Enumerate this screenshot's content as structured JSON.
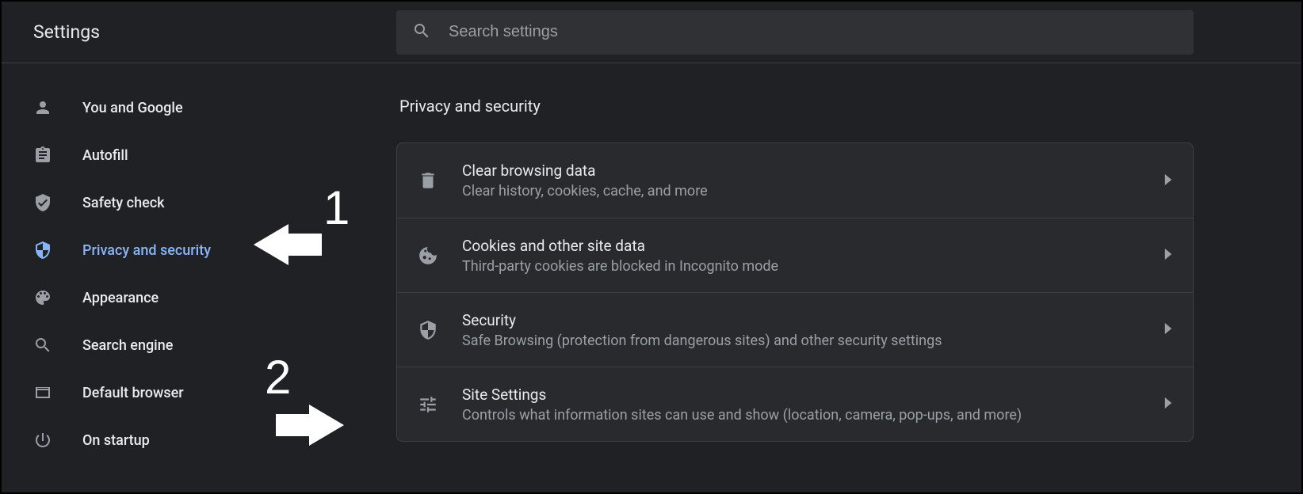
{
  "app_title": "Settings",
  "search": {
    "placeholder": "Search settings"
  },
  "sidebar": {
    "items": [
      {
        "id": "you-and-google",
        "label": "You and Google",
        "icon": "person"
      },
      {
        "id": "autofill",
        "label": "Autofill",
        "icon": "assignment"
      },
      {
        "id": "safety-check",
        "label": "Safety check",
        "icon": "verified-shield"
      },
      {
        "id": "privacy-security",
        "label": "Privacy and security",
        "icon": "security",
        "selected": true
      },
      {
        "id": "appearance",
        "label": "Appearance",
        "icon": "palette"
      },
      {
        "id": "search-engine",
        "label": "Search engine",
        "icon": "search"
      },
      {
        "id": "default-browser",
        "label": "Default browser",
        "icon": "browser"
      },
      {
        "id": "on-startup",
        "label": "On startup",
        "icon": "power"
      }
    ]
  },
  "main": {
    "section_title": "Privacy and security",
    "rows": [
      {
        "title": "Clear browsing data",
        "subtitle": "Clear history, cookies, cache, and more",
        "icon": "delete"
      },
      {
        "title": "Cookies and other site data",
        "subtitle": "Third-party cookies are blocked in Incognito mode",
        "icon": "cookie"
      },
      {
        "title": "Security",
        "subtitle": "Safe Browsing (protection from dangerous sites) and other security settings",
        "icon": "security"
      },
      {
        "title": "Site Settings",
        "subtitle": "Controls what information sites can use and show (location, camera, pop-ups, and more)",
        "icon": "tune"
      }
    ]
  },
  "annotations": [
    {
      "number": "1",
      "points_to": "sidebar-item-privacy-security"
    },
    {
      "number": "2",
      "points_to": "row-site-settings"
    }
  ]
}
